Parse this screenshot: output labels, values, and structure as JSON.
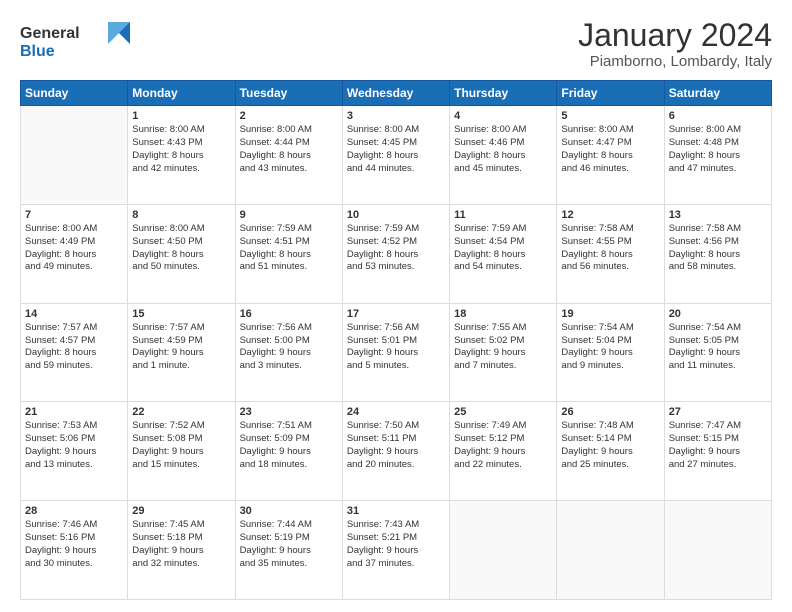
{
  "logo": {
    "line1": "General",
    "line2": "Blue"
  },
  "title": "January 2024",
  "location": "Piamborno, Lombardy, Italy",
  "weekdays": [
    "Sunday",
    "Monday",
    "Tuesday",
    "Wednesday",
    "Thursday",
    "Friday",
    "Saturday"
  ],
  "weeks": [
    [
      {
        "day": "",
        "info": ""
      },
      {
        "day": "1",
        "info": "Sunrise: 8:00 AM\nSunset: 4:43 PM\nDaylight: 8 hours\nand 42 minutes."
      },
      {
        "day": "2",
        "info": "Sunrise: 8:00 AM\nSunset: 4:44 PM\nDaylight: 8 hours\nand 43 minutes."
      },
      {
        "day": "3",
        "info": "Sunrise: 8:00 AM\nSunset: 4:45 PM\nDaylight: 8 hours\nand 44 minutes."
      },
      {
        "day": "4",
        "info": "Sunrise: 8:00 AM\nSunset: 4:46 PM\nDaylight: 8 hours\nand 45 minutes."
      },
      {
        "day": "5",
        "info": "Sunrise: 8:00 AM\nSunset: 4:47 PM\nDaylight: 8 hours\nand 46 minutes."
      },
      {
        "day": "6",
        "info": "Sunrise: 8:00 AM\nSunset: 4:48 PM\nDaylight: 8 hours\nand 47 minutes."
      }
    ],
    [
      {
        "day": "7",
        "info": "Sunrise: 8:00 AM\nSunset: 4:49 PM\nDaylight: 8 hours\nand 49 minutes."
      },
      {
        "day": "8",
        "info": "Sunrise: 8:00 AM\nSunset: 4:50 PM\nDaylight: 8 hours\nand 50 minutes."
      },
      {
        "day": "9",
        "info": "Sunrise: 7:59 AM\nSunset: 4:51 PM\nDaylight: 8 hours\nand 51 minutes."
      },
      {
        "day": "10",
        "info": "Sunrise: 7:59 AM\nSunset: 4:52 PM\nDaylight: 8 hours\nand 53 minutes."
      },
      {
        "day": "11",
        "info": "Sunrise: 7:59 AM\nSunset: 4:54 PM\nDaylight: 8 hours\nand 54 minutes."
      },
      {
        "day": "12",
        "info": "Sunrise: 7:58 AM\nSunset: 4:55 PM\nDaylight: 8 hours\nand 56 minutes."
      },
      {
        "day": "13",
        "info": "Sunrise: 7:58 AM\nSunset: 4:56 PM\nDaylight: 8 hours\nand 58 minutes."
      }
    ],
    [
      {
        "day": "14",
        "info": "Sunrise: 7:57 AM\nSunset: 4:57 PM\nDaylight: 8 hours\nand 59 minutes."
      },
      {
        "day": "15",
        "info": "Sunrise: 7:57 AM\nSunset: 4:59 PM\nDaylight: 9 hours\nand 1 minute."
      },
      {
        "day": "16",
        "info": "Sunrise: 7:56 AM\nSunset: 5:00 PM\nDaylight: 9 hours\nand 3 minutes."
      },
      {
        "day": "17",
        "info": "Sunrise: 7:56 AM\nSunset: 5:01 PM\nDaylight: 9 hours\nand 5 minutes."
      },
      {
        "day": "18",
        "info": "Sunrise: 7:55 AM\nSunset: 5:02 PM\nDaylight: 9 hours\nand 7 minutes."
      },
      {
        "day": "19",
        "info": "Sunrise: 7:54 AM\nSunset: 5:04 PM\nDaylight: 9 hours\nand 9 minutes."
      },
      {
        "day": "20",
        "info": "Sunrise: 7:54 AM\nSunset: 5:05 PM\nDaylight: 9 hours\nand 11 minutes."
      }
    ],
    [
      {
        "day": "21",
        "info": "Sunrise: 7:53 AM\nSunset: 5:06 PM\nDaylight: 9 hours\nand 13 minutes."
      },
      {
        "day": "22",
        "info": "Sunrise: 7:52 AM\nSunset: 5:08 PM\nDaylight: 9 hours\nand 15 minutes."
      },
      {
        "day": "23",
        "info": "Sunrise: 7:51 AM\nSunset: 5:09 PM\nDaylight: 9 hours\nand 18 minutes."
      },
      {
        "day": "24",
        "info": "Sunrise: 7:50 AM\nSunset: 5:11 PM\nDaylight: 9 hours\nand 20 minutes."
      },
      {
        "day": "25",
        "info": "Sunrise: 7:49 AM\nSunset: 5:12 PM\nDaylight: 9 hours\nand 22 minutes."
      },
      {
        "day": "26",
        "info": "Sunrise: 7:48 AM\nSunset: 5:14 PM\nDaylight: 9 hours\nand 25 minutes."
      },
      {
        "day": "27",
        "info": "Sunrise: 7:47 AM\nSunset: 5:15 PM\nDaylight: 9 hours\nand 27 minutes."
      }
    ],
    [
      {
        "day": "28",
        "info": "Sunrise: 7:46 AM\nSunset: 5:16 PM\nDaylight: 9 hours\nand 30 minutes."
      },
      {
        "day": "29",
        "info": "Sunrise: 7:45 AM\nSunset: 5:18 PM\nDaylight: 9 hours\nand 32 minutes."
      },
      {
        "day": "30",
        "info": "Sunrise: 7:44 AM\nSunset: 5:19 PM\nDaylight: 9 hours\nand 35 minutes."
      },
      {
        "day": "31",
        "info": "Sunrise: 7:43 AM\nSunset: 5:21 PM\nDaylight: 9 hours\nand 37 minutes."
      },
      {
        "day": "",
        "info": ""
      },
      {
        "day": "",
        "info": ""
      },
      {
        "day": "",
        "info": ""
      }
    ]
  ]
}
